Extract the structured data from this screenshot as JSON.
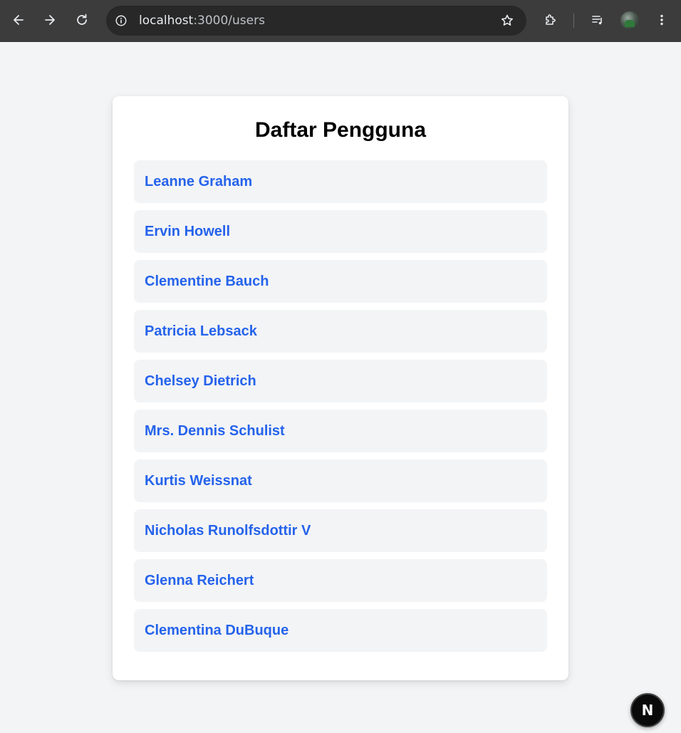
{
  "browser": {
    "url_host": "localhost",
    "url_path": ":3000/users",
    "icons": [
      "back-icon",
      "forward-icon",
      "reload-icon",
      "info-icon",
      "star-icon",
      "extensions-icon",
      "media-icon",
      "menu-icon"
    ]
  },
  "page": {
    "title": "Daftar Pengguna",
    "users": [
      "Leanne Graham",
      "Ervin Howell",
      "Clementine Bauch",
      "Patricia Lebsack",
      "Chelsey Dietrich",
      "Mrs. Dennis Schulist",
      "Kurtis Weissnat",
      "Nicholas Runolfsdottir V",
      "Glenna Reichert",
      "Clementina DuBuque"
    ],
    "link_color": "#2563eb"
  },
  "next_badge": {
    "label": "N"
  }
}
